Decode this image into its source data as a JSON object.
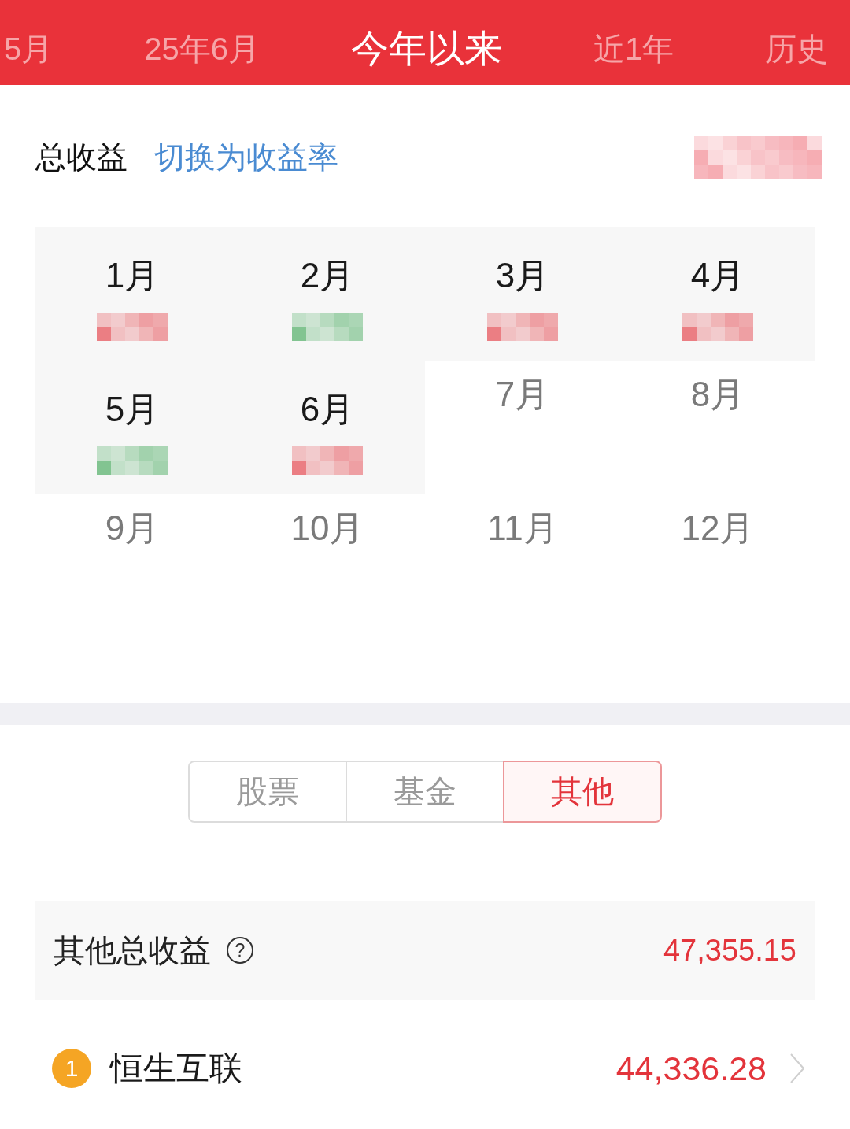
{
  "period_tabs": [
    {
      "label": "5月",
      "selected": false
    },
    {
      "label": "25年6月",
      "selected": false
    },
    {
      "label": "今年以来",
      "selected": true
    },
    {
      "label": "近1年",
      "selected": false
    },
    {
      "label": "历史",
      "selected": false
    }
  ],
  "summary_header": {
    "title": "总收益",
    "switch_link": "切换为收益率",
    "total_redacted": true
  },
  "months": [
    {
      "label": "1月",
      "elapsed": true,
      "gain": true
    },
    {
      "label": "2月",
      "elapsed": true,
      "gain": false
    },
    {
      "label": "3月",
      "elapsed": true,
      "gain": true
    },
    {
      "label": "4月",
      "elapsed": true,
      "gain": true
    },
    {
      "label": "5月",
      "elapsed": true,
      "gain": false
    },
    {
      "label": "6月",
      "elapsed": true,
      "gain": true
    },
    {
      "label": "7月",
      "elapsed": false
    },
    {
      "label": "8月",
      "elapsed": false
    },
    {
      "label": "9月",
      "elapsed": false
    },
    {
      "label": "10月",
      "elapsed": false
    },
    {
      "label": "11月",
      "elapsed": false
    },
    {
      "label": "12月",
      "elapsed": false
    }
  ],
  "category_tabs": [
    {
      "label": "股票",
      "selected": false
    },
    {
      "label": "基金",
      "selected": false
    },
    {
      "label": "其他",
      "selected": true
    }
  ],
  "category_total": {
    "label": "其他总收益",
    "help_glyph": "?",
    "value": "47,355.15",
    "gain": true
  },
  "holdings": [
    {
      "rank": "1",
      "name": "恒生互联",
      "value": "44,336.28",
      "gain": true
    }
  ]
}
